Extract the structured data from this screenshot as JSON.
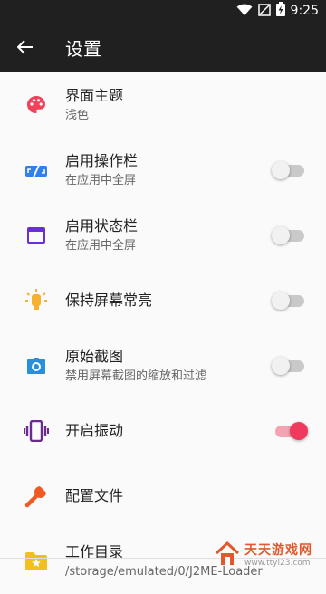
{
  "status_bar": {
    "time": "9:25"
  },
  "toolbar": {
    "title": "设置"
  },
  "settings": [
    {
      "title": "界面主题",
      "subtitle": "浅色",
      "icon": "palette-icon",
      "color": "#f0435b"
    },
    {
      "title": "启用操作栏",
      "subtitle": "在应用中全屏",
      "icon": "aspect-ratio-icon",
      "color": "#2f80ed",
      "switch": false
    },
    {
      "title": "启用状态栏",
      "subtitle": "在应用中全屏",
      "icon": "window-icon",
      "color": "#6a2fd6",
      "switch": false
    },
    {
      "title": "保持屏幕常亮",
      "subtitle": "",
      "icon": "lightbulb-icon",
      "color": "#f5b231",
      "switch": false
    },
    {
      "title": "原始截图",
      "subtitle": "禁用屏幕截图的缩放和过滤",
      "icon": "camera-icon",
      "color": "#2a8fd8",
      "switch": false
    },
    {
      "title": "开启振动",
      "subtitle": "",
      "icon": "vibration-icon",
      "color": "#6a2a8e",
      "switch": true
    },
    {
      "title": "配置文件",
      "subtitle": "",
      "icon": "wrench-icon",
      "color": "#ef5a24"
    },
    {
      "title": "工作目录",
      "subtitle": "/storage/emulated/0/J2ME-Loader",
      "icon": "folder-star-icon",
      "color": "#f2c01e"
    }
  ],
  "watermark": {
    "main": "天天游戏网",
    "sub": "www.ttyl23.com"
  },
  "colors": {
    "accent": "#ef3a5d",
    "toolbar": "#202020"
  }
}
